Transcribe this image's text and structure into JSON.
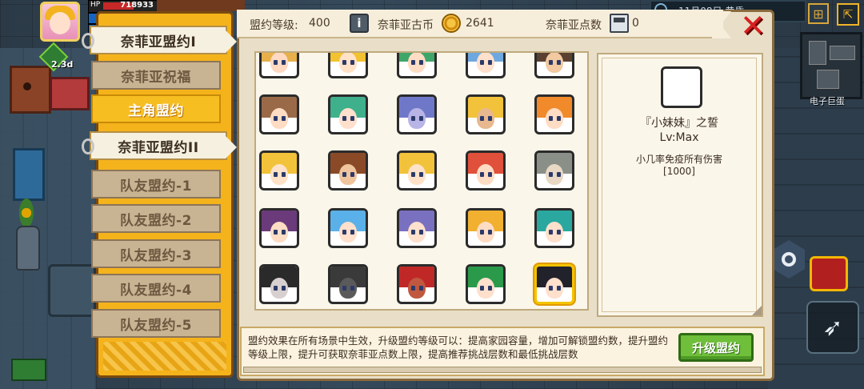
{
  "hud": {
    "hp_label": "HP",
    "hp_value": "718933",
    "speed": "2.3d",
    "hp_fill": 0.82
  },
  "topbar": {
    "date": "11月08日  黄昏",
    "globe_icon": "globe-icon",
    "exit_icon": "exit-icon"
  },
  "minimap": {
    "label": "电子巨蛋"
  },
  "tabs": [
    {
      "label": "奈菲亚盟约I",
      "state": "active"
    },
    {
      "label": "奈菲亚祝福",
      "state": "normal"
    },
    {
      "label": "主角盟约",
      "state": "gold"
    },
    {
      "label": "奈菲亚盟约II",
      "state": "active"
    },
    {
      "label": "队友盟约-1",
      "state": "normal"
    },
    {
      "label": "队友盟约-2",
      "state": "normal"
    },
    {
      "label": "队友盟约-3",
      "state": "normal"
    },
    {
      "label": "队友盟约-4",
      "state": "normal"
    },
    {
      "label": "队友盟约-5",
      "state": "normal"
    }
  ],
  "header": {
    "level_label": "盟约等级:",
    "level_value": "400",
    "coin_label": "奈菲亚古币",
    "coin_value": "2641",
    "points_label": "奈菲亚点数",
    "points_value": "0",
    "close_icon": "close-icon"
  },
  "portraits": [
    {
      "hair": "#e8b04a",
      "skin": "#ffd9c2"
    },
    {
      "hair": "#f2c230",
      "skin": "#ffe2c8"
    },
    {
      "hair": "#3fa66a",
      "skin": "#ffdcc4"
    },
    {
      "hair": "#6fa8e0",
      "skin": "#ffe0cc"
    },
    {
      "hair": "#5a4030",
      "skin": "#f2c9a0"
    },
    {
      "hair": "#9a6a48",
      "skin": "#ffdcc4"
    },
    {
      "hair": "#3fb08c",
      "skin": "#ffe0cc"
    },
    {
      "hair": "#6f78c8",
      "skin": "#b8b4e6"
    },
    {
      "hair": "#f2c23a",
      "skin": "#e8b88e"
    },
    {
      "hair": "#f08a2a",
      "skin": "#ffdcc4"
    },
    {
      "hair": "#f2c23a",
      "skin": "#ffe2c8"
    },
    {
      "hair": "#8a4a28",
      "skin": "#f0c49c"
    },
    {
      "hair": "#f2c23a",
      "skin": "#ffe2c8"
    },
    {
      "hair": "#e0503a",
      "skin": "#ffdcc4"
    },
    {
      "hair": "#8a9088",
      "skin": "#e8d8c4"
    },
    {
      "hair": "#6a3a7a",
      "skin": "#ffdcc4"
    },
    {
      "hair": "#5ab0e8",
      "skin": "#ffe0cc"
    },
    {
      "hair": "#7a70c0",
      "skin": "#ffe0cc"
    },
    {
      "hair": "#f2b030",
      "skin": "#ffdcc4"
    },
    {
      "hair": "#2aa8a0",
      "skin": "#ffe0cc"
    },
    {
      "hair": "#2a2a2a",
      "skin": "#d8d0d0"
    },
    {
      "hair": "#3a3a3a",
      "skin": "#5a5a5a"
    },
    {
      "hair": "#c02828",
      "skin": "#c05840"
    },
    {
      "hair": "#2a9a4a",
      "skin": "#ffe0cc"
    },
    {
      "hair": "#22222c",
      "skin": "#ffe0cc"
    }
  ],
  "selected_index": 24,
  "detail": {
    "title": "『小妹妹』之誓",
    "level": "Lv:Max",
    "description": "小几率免疫所有伤害",
    "value": "[1000]"
  },
  "footer": {
    "text": "盟约效果在所有场景中生效，升级盟约等级可以：提高家园容量，增加可解锁盟约数，提升盟约等级上限，提升可获取奈菲亚点数上限，提高推荐挑战层数和最低挑战层数",
    "upgrade_label": "升级盟约"
  },
  "colors": {
    "tab_column": "#f5b31b",
    "panel_bg": "#e9dfc8",
    "upgrade_green": "#6fbf3a",
    "close_red": "#d82020"
  }
}
